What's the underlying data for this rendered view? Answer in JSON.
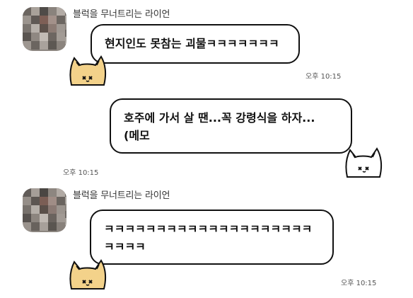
{
  "messages": [
    {
      "sender": "블럭을 무너트리는 라이언",
      "text": "현지인도 못참는 괴물ㅋㅋㅋㅋㅋㅋㅋ",
      "time": "오후 10:15"
    },
    {
      "text": "호주에 가서 살 땐...꼭 강령식을 하자...\n(메모",
      "time": "오후 10:15"
    },
    {
      "sender": "블럭을 무너트리는 라이언",
      "text": "ㅋㅋㅋㅋㅋㅋㅋㅋㅋㅋㅋㅋㅋㅋㅋㅋㅋㅋㅋㅋ\nㅋㅋㅋㅋ",
      "time": "오후 10:15"
    }
  ],
  "colors": {
    "cat_orange": "#f3d28a",
    "cat_white": "#ffffff",
    "bubble_border": "#111111"
  },
  "icons": [
    "pixelated-avatar",
    "orange-cat-icon",
    "white-cat-icon"
  ]
}
